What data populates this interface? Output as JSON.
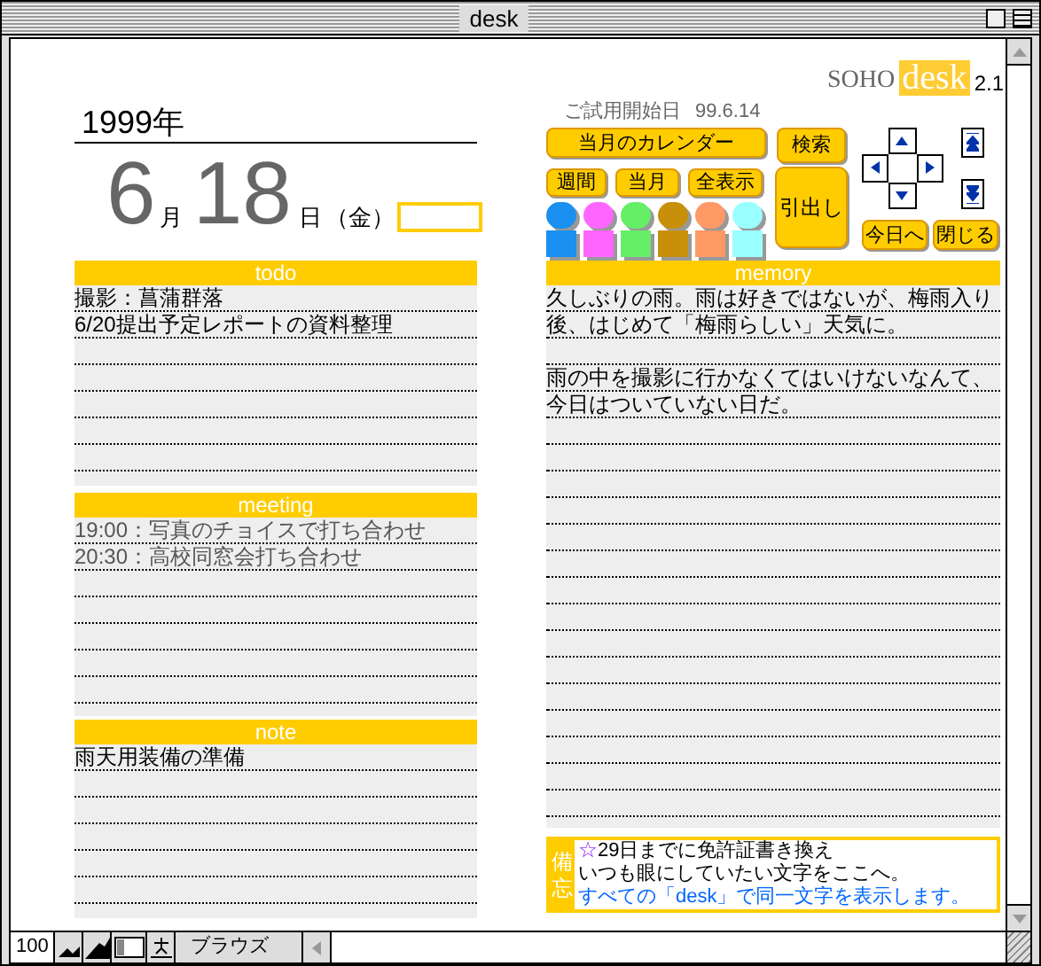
{
  "window": {
    "title": "desk"
  },
  "logo": {
    "brand": "SOHO",
    "product": "desk",
    "version": "2.1"
  },
  "trial": {
    "label": "ご試用開始日",
    "date": "99.6.14"
  },
  "date": {
    "year": "1999年",
    "month": "6",
    "month_unit": "月",
    "day": "18",
    "day_unit": "日",
    "weekday": "（金）"
  },
  "buttons": [
    {
      "label": "当月のカレンダー",
      "kind": "wide"
    },
    {
      "label": "検索",
      "kind": "small"
    }
  ],
  "view_buttons": [
    {
      "label": "週間"
    },
    {
      "label": "当月"
    },
    {
      "label": "全表示"
    }
  ],
  "drawer_button": {
    "label": "引出し"
  },
  "palette": [
    {
      "color": "#1a90f0"
    },
    {
      "color": "#ff66ff"
    },
    {
      "color": "#66ee66"
    },
    {
      "color": "#c8900a"
    },
    {
      "color": "#ff9966"
    },
    {
      "color": "#99ffff"
    }
  ],
  "nav_buttons": [
    {
      "label": "今日へ"
    },
    {
      "label": "閉じる"
    }
  ],
  "sections": [
    {
      "title": "todo",
      "kind": "dark",
      "lines": [
        " 撮影：菖蒲群落",
        "6/20提出予定レポートの資料整理"
      ]
    },
    {
      "title": "meeting",
      "kind": "gray",
      "lines": [
        "19:00：写真のチョイスで打ち合わせ",
        "20:30：高校同窓会打ち合わせ"
      ]
    },
    {
      "title": "note",
      "kind": "dark",
      "lines": [
        "雨天用装備の準備"
      ]
    }
  ],
  "memory": {
    "title": "memory",
    "paragraphs": [
      [
        "久しぶりの雨。雨は好きではないが、梅雨入り",
        "後、はじめて「梅雨らしい」天気に。"
      ],
      [
        "雨の中を撮影に行かなくてはいけないなんて、",
        "今日はついていない日だ。"
      ]
    ]
  },
  "memo": {
    "label": "備忘",
    "lines": [
      {
        "kind": "star",
        "mark": "☆",
        "text": "29日までに免許証書き換え"
      },
      {
        "kind": "plain",
        "text": "いつも眼にしていたい文字をここへ。"
      },
      {
        "kind": "info",
        "text": "すべての「desk」で同一文字を表示します。"
      }
    ]
  },
  "status_bar": {
    "zoom": "100",
    "mode": "ブラウズ"
  }
}
